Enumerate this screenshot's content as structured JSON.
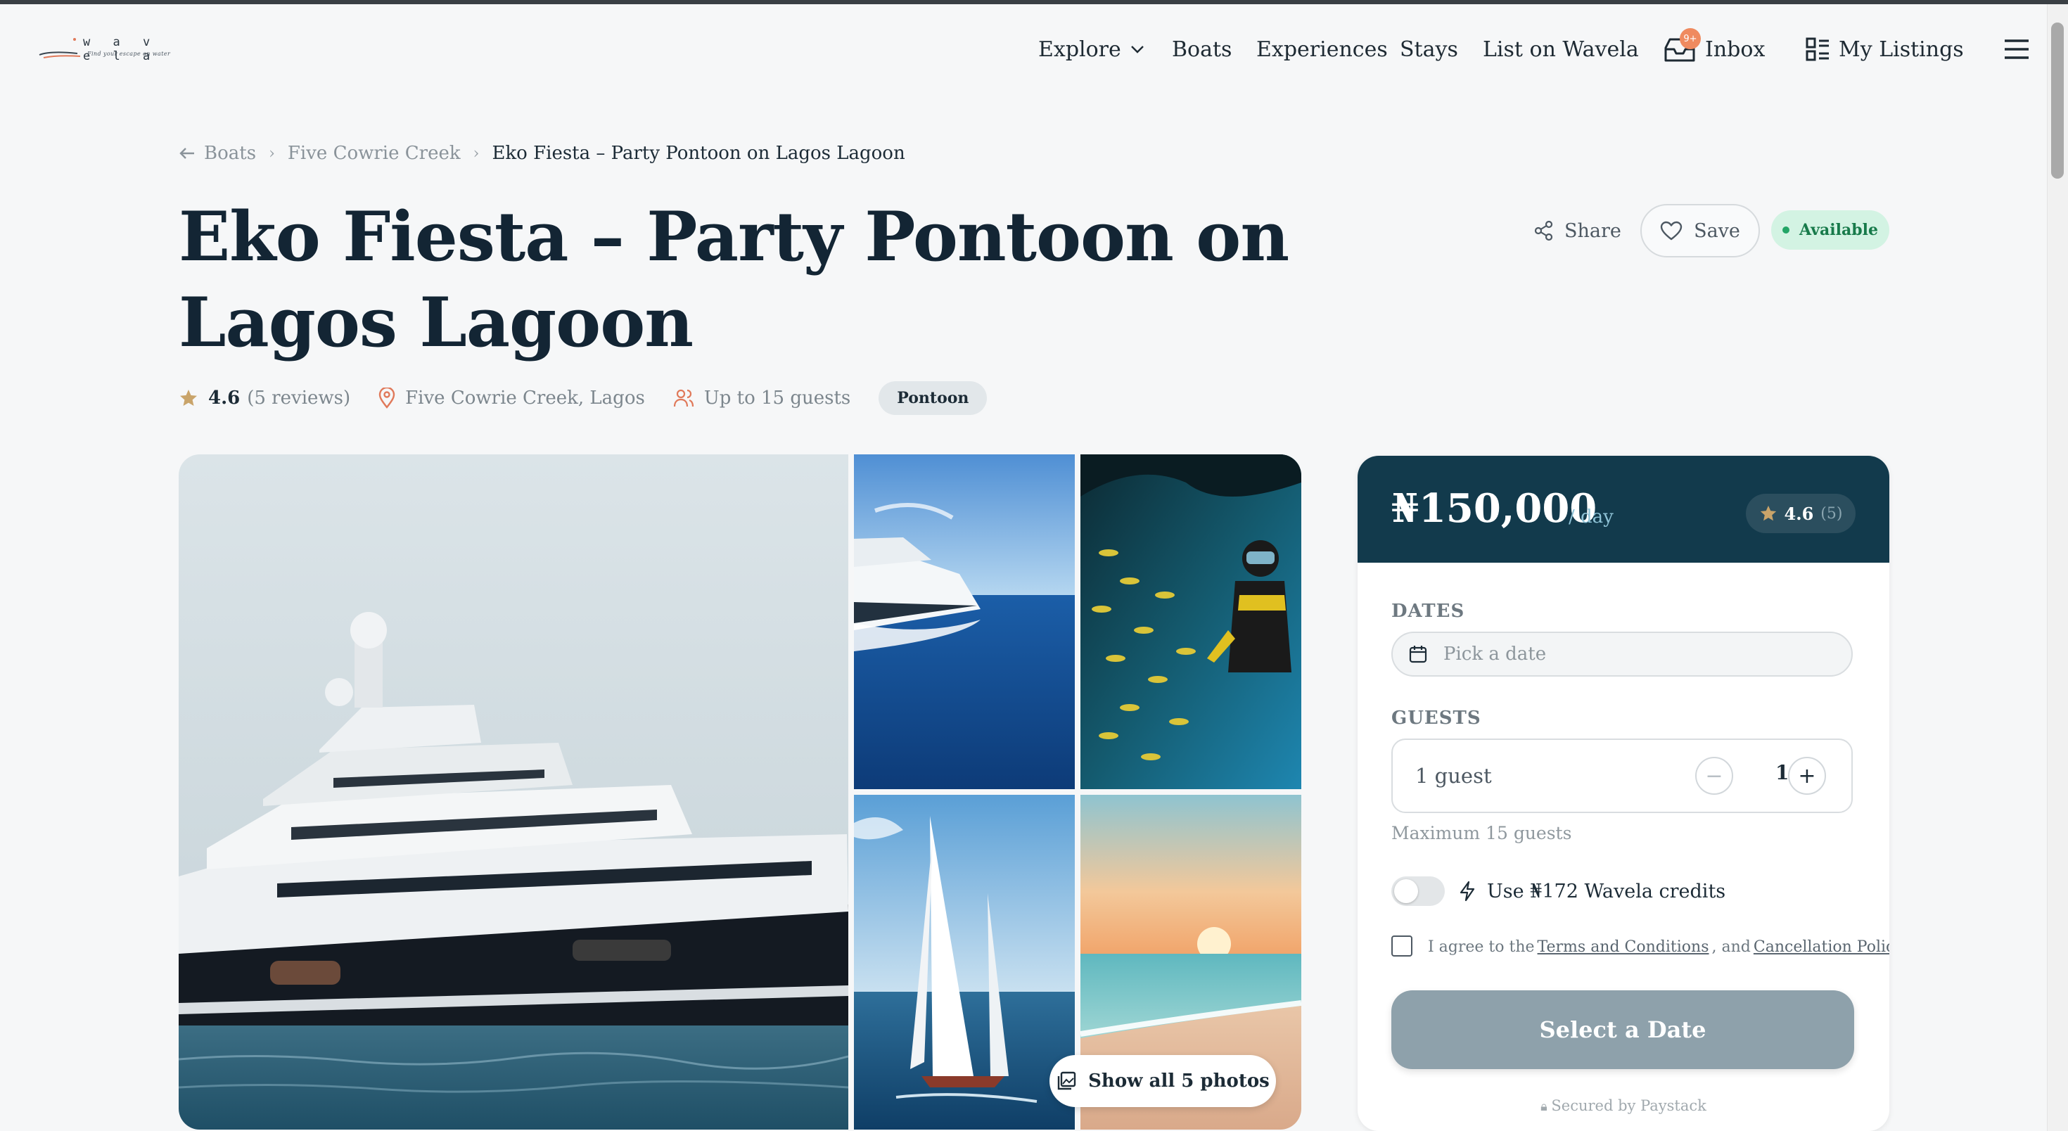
{
  "brand": {
    "name": "w a v e l a",
    "tagline": "Find your escape on water"
  },
  "nav": {
    "explore": "Explore",
    "boats": "Boats",
    "experiences": "Experiences",
    "stays": "Stays",
    "list": "List on Wavela",
    "inbox": "Inbox",
    "inbox_badge": "9+",
    "my_listings": "My Listings",
    "menu_icon": "hamburger-icon"
  },
  "breadcrumb": {
    "back_icon": "arrow-left-icon",
    "items": [
      "Boats",
      "Five Cowrie Creek",
      "Eko Fiesta – Party Pontoon on Lagos Lagoon"
    ]
  },
  "listing": {
    "title": "Eko Fiesta – Party Pontoon on Lagos Lagoon",
    "rating": "4.6",
    "reviews": "(5 reviews)",
    "location": "Five Cowrie Creek, Lagos",
    "capacity": "Up to 15 guests",
    "type": "Pontoon",
    "status": "Available",
    "share_label": "Share",
    "save_label": "Save"
  },
  "gallery": {
    "show_all": "Show all 5 photos",
    "photos": [
      "superyacht",
      "motor-yacht",
      "diver-with-fish",
      "sailboat",
      "beach-sunset"
    ]
  },
  "booking": {
    "price": "₦150,000",
    "per": "/ day",
    "rating": "4.6",
    "rating_count": "(5)",
    "dates_label": "DATES",
    "dates_placeholder": "Pick a date",
    "guests_label": "GUESTS",
    "guests_text": "1 guest",
    "guest_count": "1",
    "max_guests": "Maximum 15 guests",
    "credits": "Use ₦172 Wavela credits",
    "agree_prefix": "I agree to the",
    "terms": "Terms and Conditions",
    "agree_and": ", and",
    "cancel_policy": "Cancellation Policy",
    "cta": "Select a Date",
    "secured": "Secured by Paystack"
  },
  "colors": {
    "header_dark": "#123a4c",
    "available_bg": "#d3f3e3",
    "badge": "#ef8a5f",
    "cta_disabled": "#8ea1ab"
  }
}
